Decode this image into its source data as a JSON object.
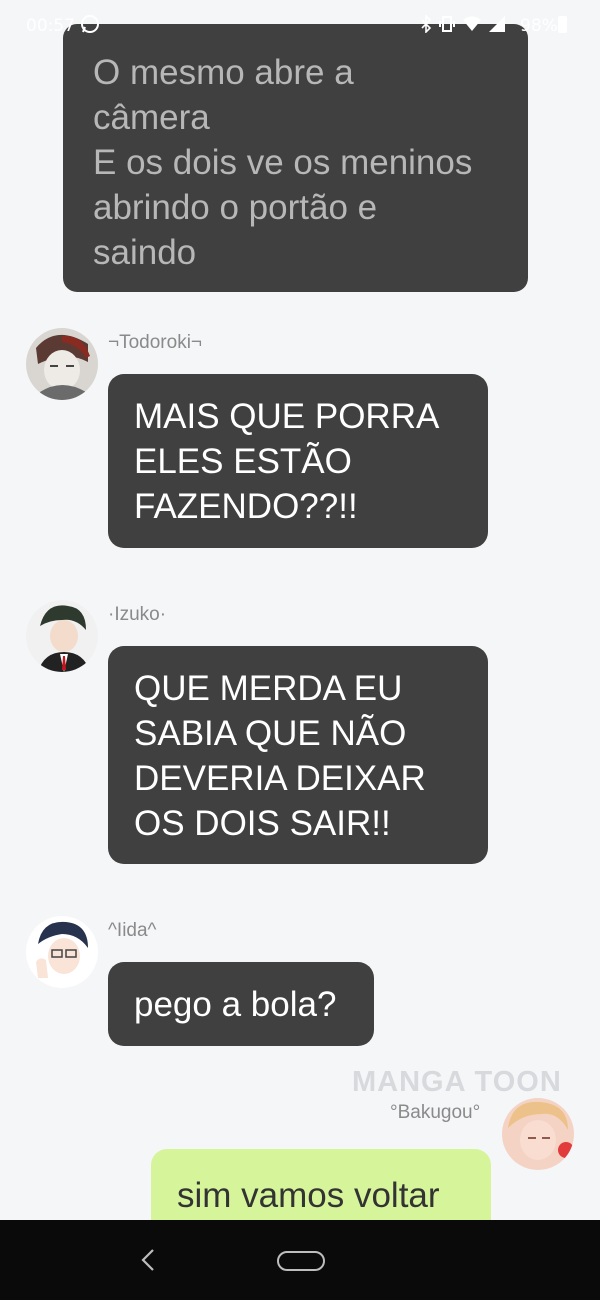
{
  "status_bar": {
    "time": "00:57",
    "battery": "98%"
  },
  "narration": {
    "text": "O mesmo abre a\ncâmera\nE os dois ve os meninos\nabrindo o portão e\nsaindo"
  },
  "messages": [
    {
      "sender": "¬Todoroki¬",
      "text": "MAIS QUE PORRA\nELES ESTÃO\nFAZENDO??!!",
      "side": "left",
      "avatar": "todoroki-avatar"
    },
    {
      "sender": "·Izuko·",
      "text": "QUE MERDA EU\nSABIA QUE NÃO\nDEVERIA DEIXAR\nOS DOIS SAIR!!",
      "side": "left",
      "avatar": "izuku-avatar"
    },
    {
      "sender": "^Iida^",
      "text": "pego a bola?",
      "side": "left",
      "avatar": "iida-avatar"
    },
    {
      "sender": "°Bakugou°",
      "text": "sim vamos voltar",
      "side": "right",
      "avatar": "bakugou-avatar"
    }
  ],
  "watermark": "MANGA TOON",
  "colors": {
    "background": "#f5f6f8",
    "bubble_dark": "#404040",
    "bubble_user": "#d6f59a",
    "nav_bar": "#0a0a0a"
  },
  "icons": [
    "whatsapp-icon",
    "bluetooth-icon",
    "vibrate-icon",
    "wifi-icon",
    "signal-icon",
    "battery-icon",
    "back-icon",
    "home-icon"
  ]
}
